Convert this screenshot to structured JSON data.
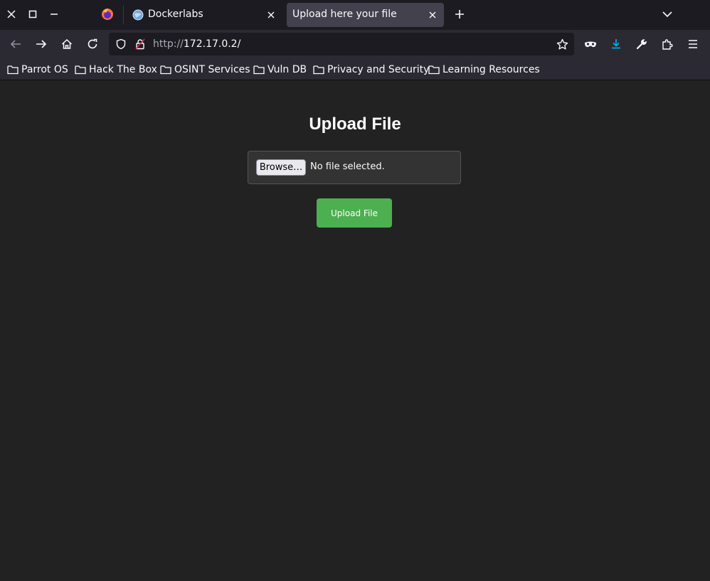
{
  "browser": {
    "tabs": [
      {
        "title": "Dockerlabs",
        "active": false
      },
      {
        "title": "Upload here your file",
        "active": true
      }
    ],
    "url_scheme": "http://",
    "url_host": "172.17.0.2/",
    "bookmarks": [
      "Parrot OS",
      "Hack The Box",
      "OSINT Services",
      "Vuln DB",
      "Privacy and Security",
      "Learning Resources"
    ],
    "accent_color": "#00b3f4"
  },
  "page": {
    "title": "Upload File",
    "browse_label": "Browse…",
    "file_status": "No file selected.",
    "submit_label": "Upload File",
    "button_color": "#4caf50"
  }
}
